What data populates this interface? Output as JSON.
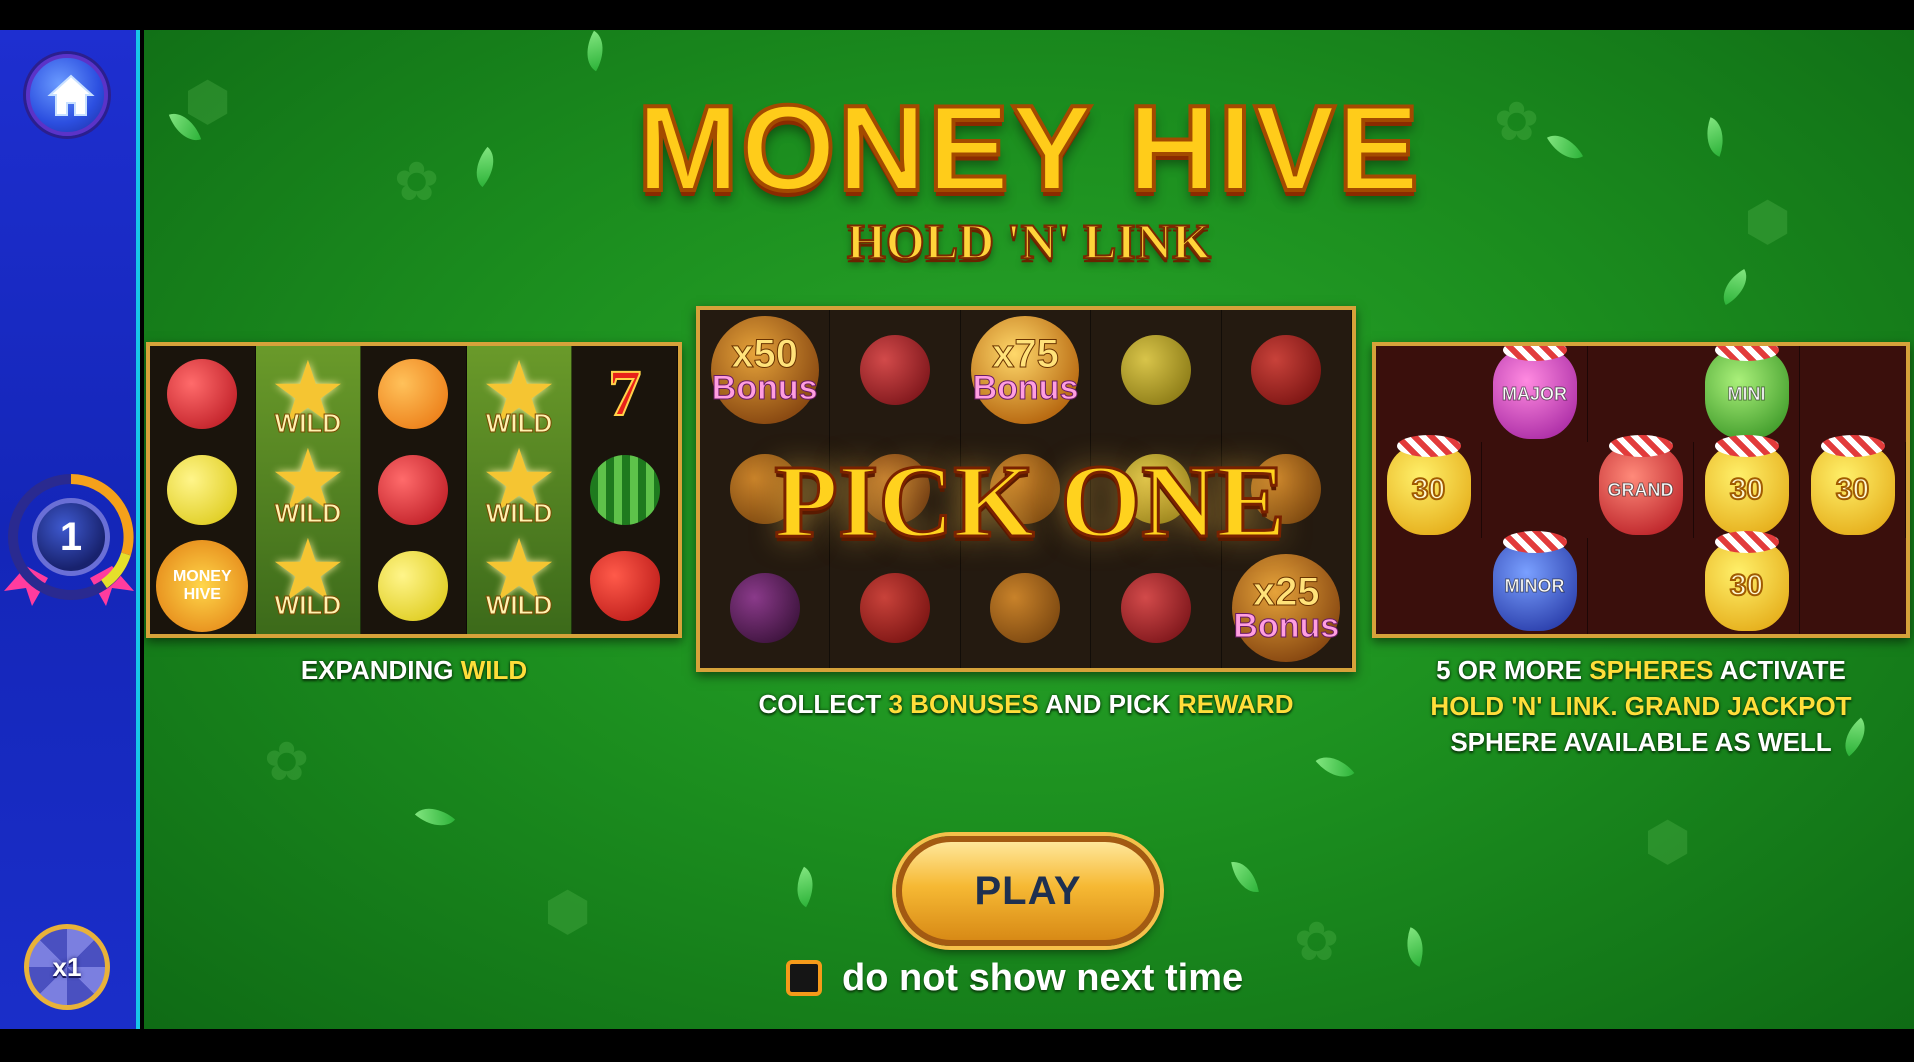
{
  "game": {
    "title": "MONEY HIVE",
    "subtitle": "HOLD 'N' LINK"
  },
  "sidebar": {
    "home_icon": "home-icon",
    "level": "1",
    "multiplier": "x1"
  },
  "panels": {
    "wild": {
      "wild_label": "WILD",
      "logo_text": "MONEY HIVE",
      "seven": "7",
      "caption_plain": "EXPANDING ",
      "caption_highlight": "WILD"
    },
    "pick": {
      "bonuses": [
        {
          "mult": "x50",
          "word": "Bonus"
        },
        {
          "mult": "x75",
          "word": "Bonus"
        },
        {
          "mult": "x25",
          "word": "Bonus"
        }
      ],
      "overlay": "PICK ONE",
      "caption_1": "COLLECT ",
      "caption_2": "3 BONUSES",
      "caption_3": " AND PICK ",
      "caption_4": "REWARD"
    },
    "hold": {
      "jars": {
        "major": "MAJOR",
        "mini": "MINI",
        "grand": "GRAND",
        "minor": "MINOR",
        "value": "30"
      },
      "line1_a": "5 OR MORE ",
      "line1_b": "SPHERES",
      "line1_c": " ACTIVATE",
      "line2": "HOLD 'N' LINK. GRAND JACKPOT",
      "line3": "SPHERE AVAILABLE AS WELL"
    }
  },
  "play_button": "PLAY",
  "dont_show_label": "do not show next time",
  "colors": {
    "background": "#1c8f1f",
    "sidebar": "#1e2fd0",
    "accent": "#ffde3a",
    "play": "#f6b934"
  }
}
